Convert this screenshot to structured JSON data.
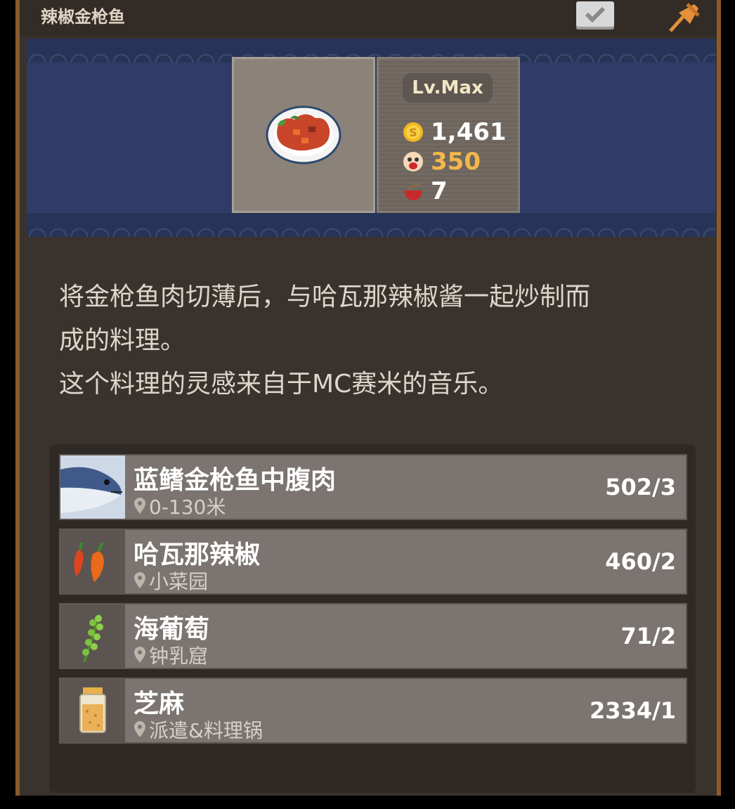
{
  "window": {
    "title": "辣椒金枪鱼",
    "check_icon": "checkmark-icon",
    "pin_icon": "pushpin-icon"
  },
  "dish": {
    "level": "Lv.Max",
    "price": "1,461",
    "taste": "350",
    "servings": "7",
    "colors": {
      "taste": "#f3b74a",
      "banner": "#2f3c68"
    }
  },
  "description": {
    "line1": "将金枪鱼肉切薄后，与哈瓦那辣椒酱一起炒制而",
    "line2": "成的料理。",
    "line3": "这个料理的灵感来自于MC赛米的音乐。"
  },
  "ingredients": [
    {
      "name": "蓝鳍金枪鱼中腹肉",
      "location": "0-130米",
      "count": "502/3",
      "icon": "tuna-icon"
    },
    {
      "name": "哈瓦那辣椒",
      "location": "小菜园",
      "count": "460/2",
      "icon": "chili-icon"
    },
    {
      "name": "海葡萄",
      "location": "钟乳窟",
      "count": "71/2",
      "icon": "sea-grape-icon"
    },
    {
      "name": "芝麻",
      "location": "派遣&料理锅",
      "count": "2334/1",
      "icon": "sesame-jar-icon"
    }
  ]
}
